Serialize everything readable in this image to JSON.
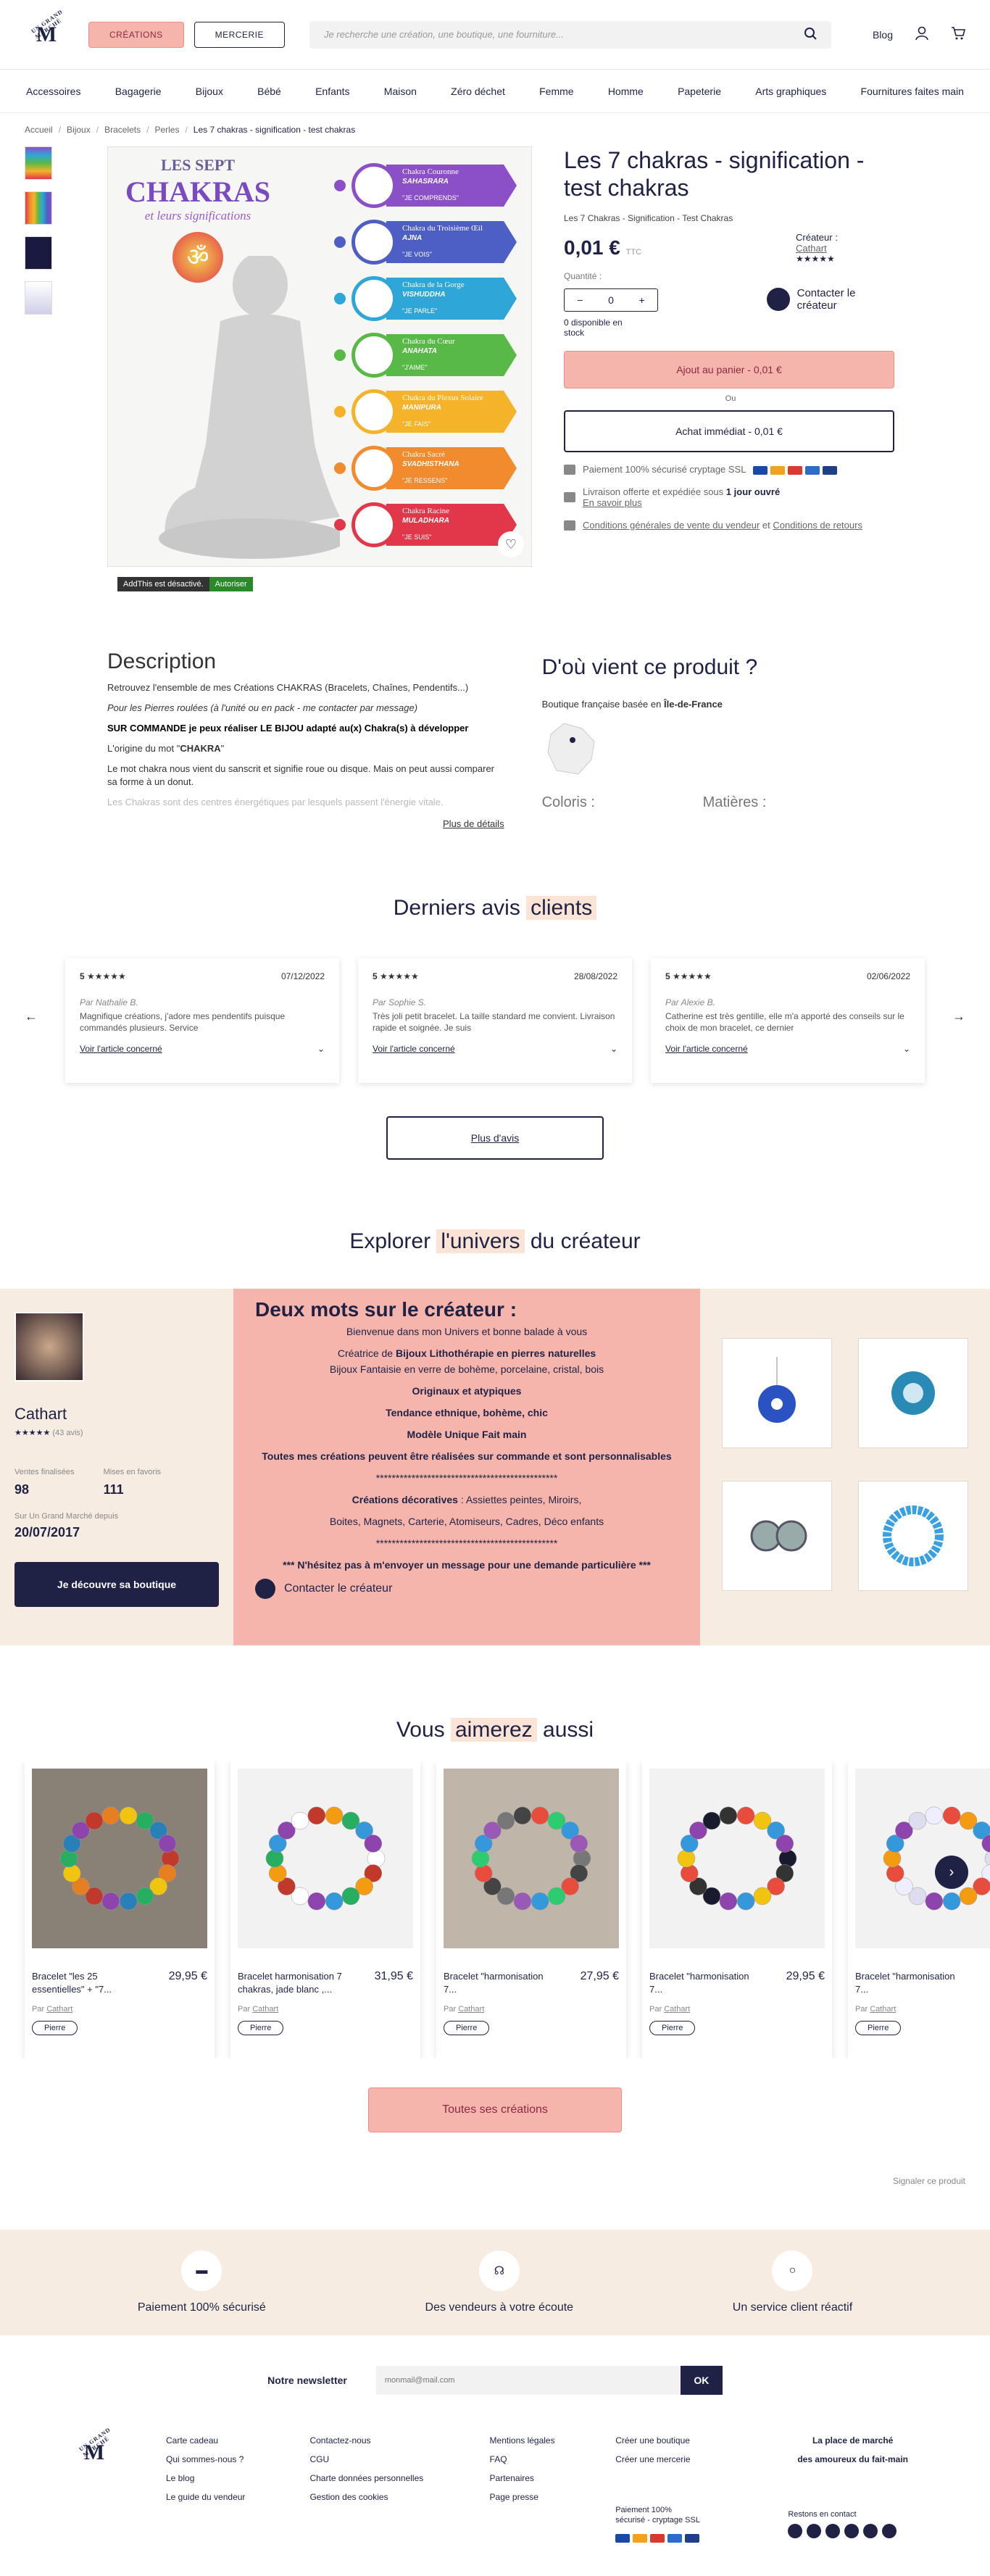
{
  "header": {
    "logo_top": "UN GRAND MARCHÉ",
    "logo_letter": "M",
    "btn_creations": "CRÉATIONS",
    "btn_mercerie": "MERCERIE",
    "search_placeholder": "Je recherche une création, une boutique, une fourniture...",
    "blog": "Blog"
  },
  "categories": [
    "Accessoires",
    "Bagagerie",
    "Bijoux",
    "Bébé",
    "Enfants",
    "Maison",
    "Zéro déchet",
    "Femme",
    "Homme",
    "Papeterie",
    "Arts graphiques",
    "Fournitures faites main"
  ],
  "breadcrumb": [
    "Accueil",
    "Bijoux",
    "Bracelets",
    "Perles",
    "Les 7 chakras - signification - test chakras"
  ],
  "product": {
    "title": "Les 7 chakras - signification - test chakras",
    "subtitle": "Les 7 Chakras - Signification - Test Chakras",
    "price": "0,01 €",
    "ttc": "TTC",
    "creator_label": "Créateur :",
    "creator_name": "Cathart",
    "stars": "★★★★★",
    "qty_label": "Quantité :",
    "qty": "0",
    "stock": "0 disponible en stock",
    "contact": "Contacter le créateur",
    "add_cart": "Ajout au panier - 0,01 €",
    "or": "Ou",
    "buy_now": "Achat immédiat - 0,01 €",
    "secure": "Paiement 100% sécurisé cryptage SSL",
    "delivery_pre": "Livraison offerte et expédiée sous",
    "delivery_bold": "1 jour ouvré",
    "learn": "En savoir plus",
    "cgv": "Conditions générales de vente du vendeur",
    "and": "et",
    "returns": "Conditions de retours",
    "addthis": "AddThis est désactivé.",
    "authorize": "Autoriser"
  },
  "chakra_img": {
    "t1": "LES SEPT",
    "t2": "CHAKRAS",
    "t3": "et leurs significations",
    "items": [
      {
        "name": "Chakra Couronne",
        "sk": "SAHASRARA",
        "motto": "\"JE COMPRENDS\"",
        "color": "#8b4fc7"
      },
      {
        "name": "Chakra du Troisième Œil",
        "sk": "AJNA",
        "motto": "\"JE VOIS\"",
        "color": "#4d5fc4"
      },
      {
        "name": "Chakra de la Gorge",
        "sk": "VISHUDDHA",
        "motto": "\"JE PARLE\"",
        "color": "#2ea6d8"
      },
      {
        "name": "Chakra du Cœur",
        "sk": "ANAHATA",
        "motto": "\"J'AIME\"",
        "color": "#58b947"
      },
      {
        "name": "Chakra du Plexus Solaire",
        "sk": "MANIPURA",
        "motto": "\"JE FAIS\"",
        "color": "#f4b329"
      },
      {
        "name": "Chakra Sacré",
        "sk": "SVADHISTHANA",
        "motto": "\"JE RESSENS\"",
        "color": "#f28a2e"
      },
      {
        "name": "Chakra Racine",
        "sk": "MULADHARA",
        "motto": "\"JE SUIS\"",
        "color": "#e2374a"
      }
    ]
  },
  "description": {
    "title": "Description",
    "p1": "Retrouvez l'ensemble de mes Créations CHAKRAS (Bracelets, Chaînes, Pendentifs...)",
    "p2": "Pour les Pierres roulées (à l'unité ou en pack - me contacter par message)",
    "p3": "SUR COMMANDE je peux réaliser LE BIJOU adapté au(x) Chakra(s) à développer",
    "p4a": "L'origine du mot \"",
    "p4b": "CHAKRA",
    "p4c": "\"",
    "p5": "Le mot chakra nous vient du sanscrit et signifie roue ou disque. Mais on peut aussi comparer sa forme à un donut.",
    "p6": "Les Chakras sont des centres énergétiques par lesquels passent l'énergie vitale.",
    "more": "Plus de détails"
  },
  "origin": {
    "title": "D'où vient ce produit ?",
    "text": "Boutique française basée en",
    "region": "Île-de-France",
    "coloris": "Coloris :",
    "matieres": "Matières :"
  },
  "reviews": {
    "title_a": "Derniers avis",
    "title_b": "clients",
    "items": [
      {
        "score": "5",
        "date": "07/12/2022",
        "by": "Par Nathalie B.",
        "text": "Magnifique créations, j'adore mes pendentifs puisque commandés plusieurs. Service",
        "link": "Voir l'article concerné"
      },
      {
        "score": "5",
        "date": "28/08/2022",
        "by": "Par Sophie S.",
        "text": "Très joli petit bracelet. La taille standard me convient. Livraison rapide et soignée. Je suis",
        "link": "Voir l'article concerné"
      },
      {
        "score": "5",
        "date": "02/06/2022",
        "by": "Par Alexie B.",
        "text": "Catherine est très gentille, elle m'a apporté des conseils sur le choix de mon bracelet, ce dernier",
        "link": "Voir l'article concerné"
      }
    ],
    "more": "Plus d'avis"
  },
  "creator": {
    "title_a": "Explorer",
    "title_b": "l'univers",
    "title_c": "du créateur",
    "name": "Cathart",
    "stars": "★★★★★",
    "reviews": "(43 avis)",
    "sold_label": "Ventes finalisées",
    "sold": "98",
    "fav_label": "Mises en favoris",
    "fav": "111",
    "since_label": "Sur Un Grand Marché depuis",
    "since": "20/07/2017",
    "shop_btn": "Je découvre sa boutique",
    "words_title": "Deux mots sur le créateur :",
    "l1": "Bienvenue dans mon Univers et bonne balade à vous",
    "l2a": "Créatrice de ",
    "l2b": "Bijoux Lithothérapie en pierres naturelles",
    "l3": "Bijoux Fantaisie en verre de bohème, porcelaine, cristal, bois",
    "l4": "Originaux et atypiques",
    "l5": "Tendance ethnique, bohème, chic",
    "l6": "Modèle Unique Fait main",
    "l7": "Toutes mes créations peuvent être réalisées sur commande et sont personnalisables",
    "stars_line": "**********************************************",
    "l8a": "Créations décoratives",
    "l8b": " : Assiettes peintes, Miroirs,",
    "l9": "Boites, Magnets, Carterie, Atomiseurs, Cadres, Déco enfants",
    "l10": "*** N'hésitez pas à m'envoyer un message pour une demande particulière ***",
    "contact": "Contacter le créateur"
  },
  "like": {
    "title_a": "Vous",
    "title_b": "aimerez",
    "title_c": "aussi",
    "by": "Par",
    "author": "Cathart",
    "tag": "Pierre",
    "items": [
      {
        "name": "Bracelet \"les 25 essentielles\" + \"7...",
        "price": "29,95 €"
      },
      {
        "name": "Bracelet harmonisation 7 chakras, jade blanc ,...",
        "price": "31,95 €"
      },
      {
        "name": "Bracelet \"harmonisation 7...",
        "price": "27,95 €"
      },
      {
        "name": "Bracelet \"harmonisation 7...",
        "price": "29,95 €"
      },
      {
        "name": "Bracelet \"harmonisation 7...",
        "price": "29,95 €"
      }
    ],
    "all": "Toutes ses créations",
    "report": "Signaler ce produit"
  },
  "features": [
    "Paiement 100% sécurisé",
    "Des vendeurs à votre écoute",
    "Un service client réactif"
  ],
  "newsletter": {
    "label": "Notre newsletter",
    "placeholder": "monmail@mail.com",
    "ok": "OK"
  },
  "footer": {
    "c1": [
      "Carte cadeau",
      "Qui sommes-nous ?",
      "Le blog",
      "Le guide du vendeur"
    ],
    "c2": [
      "Contactez-nous",
      "CGU",
      "Charte données personnelles",
      "Gestion des cookies"
    ],
    "c3": [
      "Mentions légales",
      "FAQ",
      "Partenaires",
      "Page presse"
    ],
    "c4": [
      "Créer une boutique",
      "Créer une mercerie"
    ],
    "tag1": "La place de marché",
    "tag2": "des amoureux du fait-main",
    "secure": "Paiement 100% sécurisé - cryptage SSL",
    "follow": "Restons en contact"
  },
  "colors": {
    "navy": "#1f2244",
    "pink": "#f5b5ad",
    "cream": "#f7ece2"
  }
}
